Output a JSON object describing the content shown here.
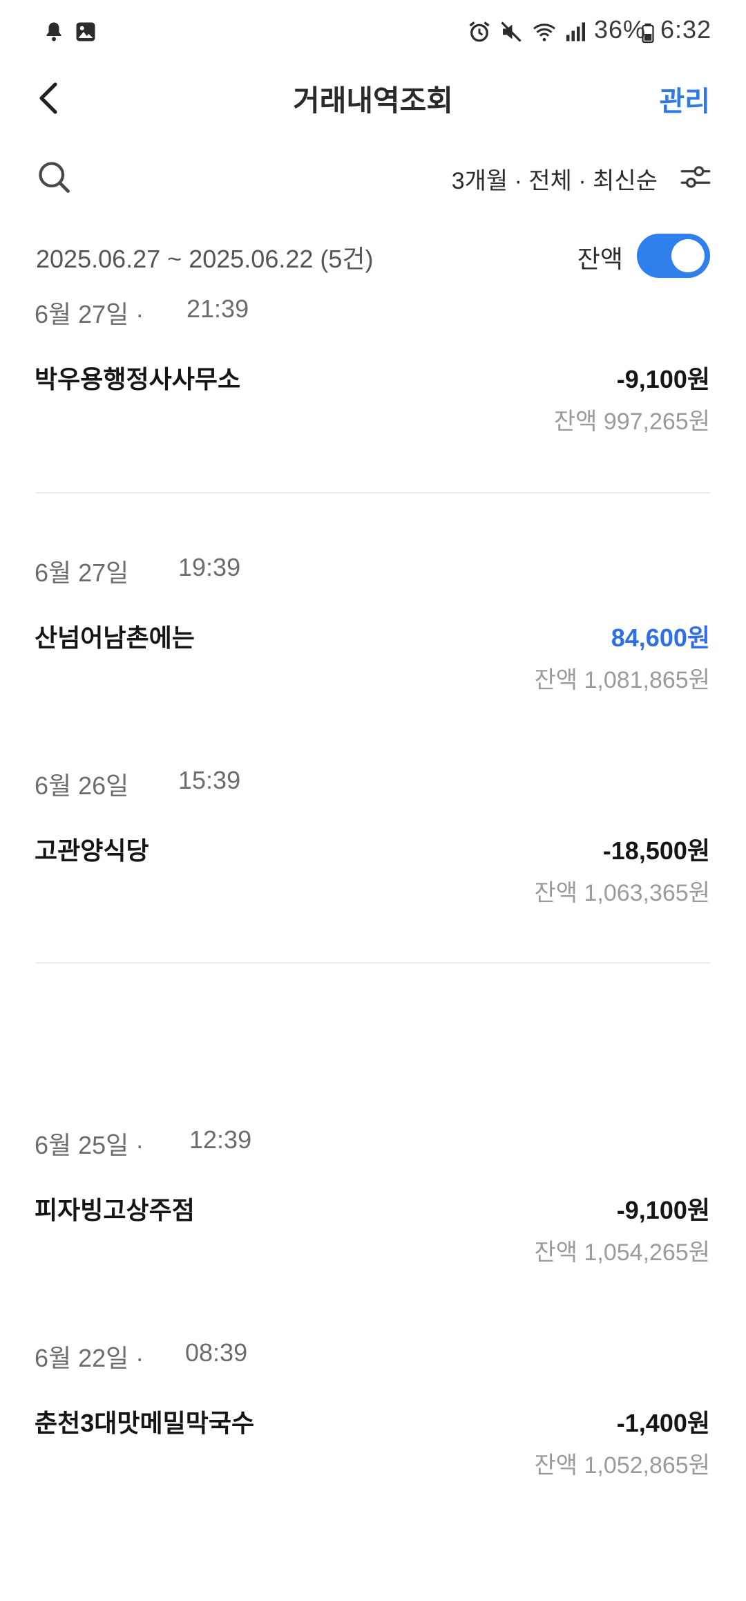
{
  "status_bar": {
    "battery": "36%",
    "time": "6:32"
  },
  "header": {
    "title": "거래내역조회",
    "manage_label": "관리"
  },
  "filter": {
    "summary": "3개월 · 전체 · 최신순"
  },
  "range": {
    "text": "2025.06.27 ~ 2025.06.22 (5건)",
    "balance_toggle_label": "잔액",
    "balance_toggle_on": true
  },
  "transactions": [
    {
      "date": "6월 27일 ·",
      "time": "21:39",
      "name": "박우용행정사사무소",
      "amount": "-9,100원",
      "balance": "잔액 997,265원"
    },
    {
      "date": "6월 27일",
      "time": "19:39",
      "name": "산넘어남촌에는",
      "amount": "84,600원",
      "balance": "잔액 1,081,865원"
    },
    {
      "date": "6월 26일",
      "time": "15:39",
      "name": "고관양식당",
      "amount": "-18,500원",
      "balance": "잔액 1,063,365원"
    },
    {
      "date": "6월 25일 ·",
      "time": "12:39",
      "name": "피자빙고상주점",
      "amount": "-9,100원",
      "balance": "잔액 1,054,265원"
    },
    {
      "date": "6월 22일 ·",
      "time": "08:39",
      "name": "춘천3대맛메밀막국수",
      "amount": "-1,400원",
      "balance": "잔액 1,052,865원"
    }
  ],
  "colors": {
    "accent": "#2f80ed",
    "positive_amount": "#2e6fe8",
    "secondary_text": "#9a9b9f"
  }
}
